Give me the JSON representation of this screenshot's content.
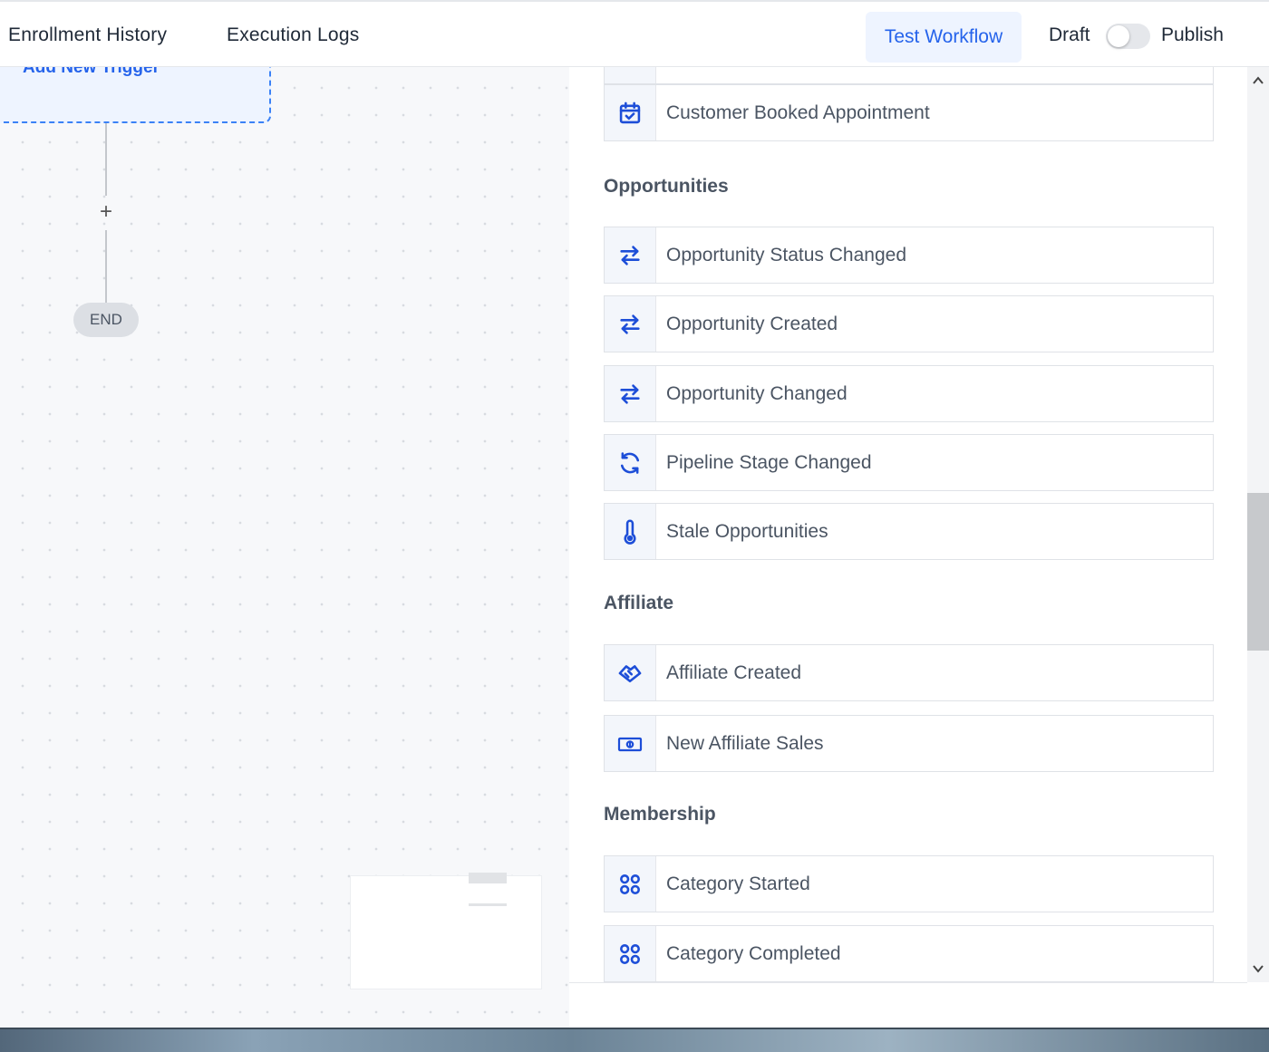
{
  "header": {
    "tabs": [
      "Enrollment History",
      "Execution Logs"
    ],
    "test_workflow_label": "Test Workflow",
    "draft_label": "Draft",
    "publish_label": "Publish",
    "publish_toggle_on": false
  },
  "canvas": {
    "trigger_label": "Add New Trigger",
    "add_step_symbol": "+",
    "end_label": "END"
  },
  "trigger_panel": {
    "items_top": [
      {
        "label": "Customer Booked Appointment",
        "icon": "calendar-check-icon"
      }
    ],
    "sections": [
      {
        "title": "Opportunities",
        "items": [
          {
            "label": "Opportunity Status Changed",
            "icon": "arrows-swap-icon"
          },
          {
            "label": "Opportunity Created",
            "icon": "arrows-swap-icon"
          },
          {
            "label": "Opportunity Changed",
            "icon": "arrows-swap-icon"
          },
          {
            "label": "Pipeline Stage Changed",
            "icon": "refresh-icon"
          },
          {
            "label": "Stale Opportunities",
            "icon": "thermometer-icon"
          }
        ]
      },
      {
        "title": "Affiliate",
        "items": [
          {
            "label": "Affiliate Created",
            "icon": "handshake-icon"
          },
          {
            "label": "New Affiliate Sales",
            "icon": "banknote-icon"
          }
        ]
      },
      {
        "title": "Membership",
        "items": [
          {
            "label": "Category Started",
            "icon": "grid-icon"
          },
          {
            "label": "Category Completed",
            "icon": "grid-icon"
          }
        ]
      }
    ]
  },
  "colors": {
    "accent": "#2563eb",
    "accent_light": "#eef4ff",
    "icon_blue": "#1d4ed8"
  }
}
